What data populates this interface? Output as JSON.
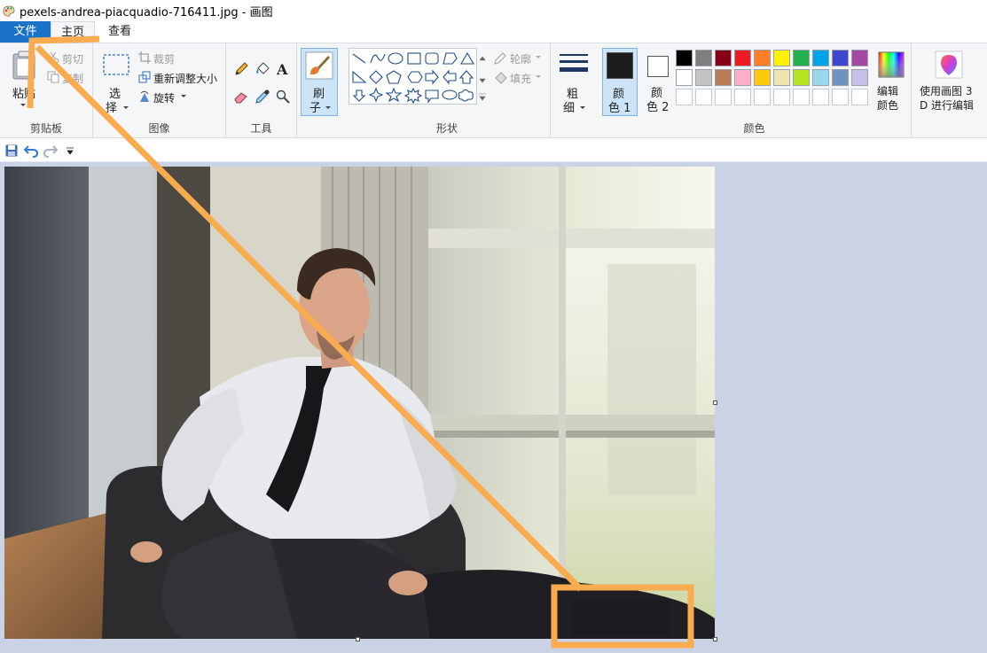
{
  "window": {
    "title": "pexels-andrea-piacquadio-716411.jpg - 画图"
  },
  "tabs": [
    {
      "label": "文件"
    },
    {
      "label": "主页"
    },
    {
      "label": "查看"
    }
  ],
  "clipboard": {
    "paste_label": "粘贴",
    "cut_label": "剪切",
    "copy_label": "复制",
    "group_label": "剪贴板"
  },
  "image": {
    "select_label_1": "选",
    "select_label_2": "择",
    "crop_label": "裁剪",
    "resize_label": "重新调整大小",
    "rotate_label": "旋转",
    "group_label": "图像"
  },
  "tools": {
    "group_label": "工具",
    "brush_label_1": "刷",
    "brush_label_2": "子"
  },
  "shapes": {
    "outline_label": "轮廓",
    "fill_label": "填充",
    "group_label": "形状"
  },
  "size": {
    "label_1": "粗",
    "label_2": "细"
  },
  "colors": {
    "color1_label_1": "颜",
    "color1_label_2": "色 1",
    "color2_label_1": "颜",
    "color2_label_2": "色 2",
    "edit_label_1": "编辑",
    "edit_label_2": "颜色",
    "group_label": "颜色",
    "color1": "#1c1c1c",
    "color2": "#ffffff",
    "palette_row1": [
      "#000000",
      "#7f7f7f",
      "#880015",
      "#ed1c24",
      "#ff7f27",
      "#fff200",
      "#22b14c",
      "#00a2e8",
      "#3f48cc",
      "#a349a4"
    ],
    "palette_row2": [
      "#ffffff",
      "#c3c3c3",
      "#b97a57",
      "#ffaec9",
      "#ffc90e",
      "#efe4b0",
      "#b5e61d",
      "#99d9ea",
      "#7092be",
      "#c8bfe7"
    ],
    "palette_row3": [
      "#ffffff",
      "#ffffff",
      "#ffffff",
      "#ffffff",
      "#ffffff",
      "#ffffff",
      "#ffffff",
      "#ffffff",
      "#ffffff",
      "#ffffff"
    ]
  },
  "paint3d": {
    "label_1": "使用画图 3",
    "label_2": "D 进行编辑"
  },
  "annotation": {
    "arrow_color": "#f9ab4f"
  }
}
